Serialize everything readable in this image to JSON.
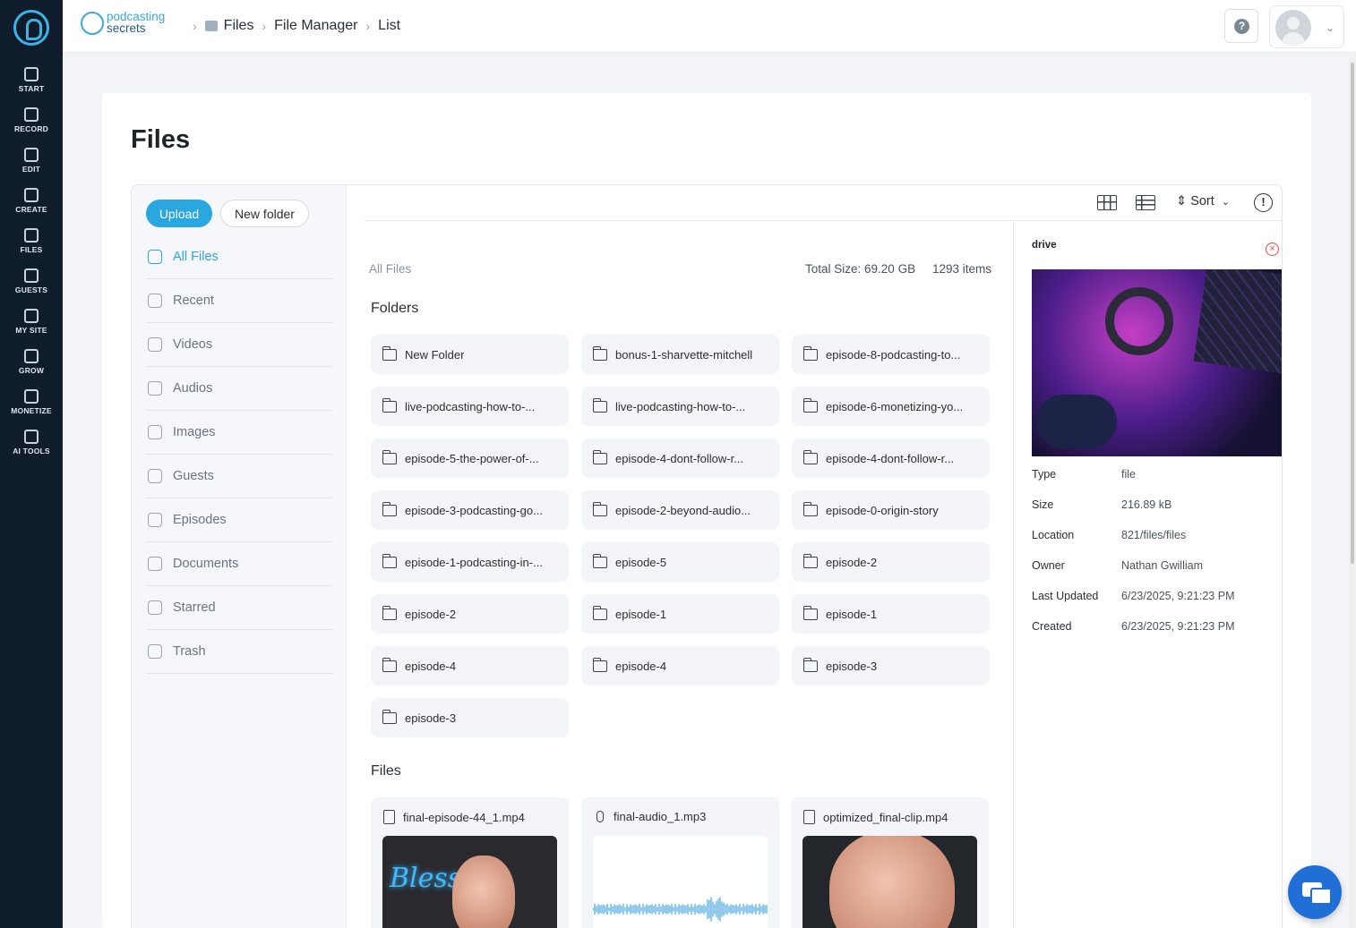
{
  "rail": {
    "items": [
      {
        "label": "START",
        "icon": "start-icon"
      },
      {
        "label": "RECORD",
        "icon": "microphone-icon"
      },
      {
        "label": "EDIT",
        "icon": "edit-icon"
      },
      {
        "label": "CREATE",
        "icon": "create-icon"
      },
      {
        "label": "FILES",
        "icon": "files-icon"
      },
      {
        "label": "GUESTS",
        "icon": "guests-icon"
      },
      {
        "label": "MY SITE",
        "icon": "site-icon"
      },
      {
        "label": "GROW",
        "icon": "chart-icon"
      },
      {
        "label": "MONETIZE",
        "icon": "monetize-icon"
      },
      {
        "label": "AI TOOLS",
        "icon": "ai-icon"
      }
    ]
  },
  "header": {
    "brand_line1": "podcasting",
    "brand_line2": "secrets",
    "breadcrumbs": [
      "Files",
      "File Manager",
      "List"
    ],
    "help_label": "?"
  },
  "page": {
    "title": "Files"
  },
  "sidebar": {
    "upload_label": "Upload",
    "new_folder_label": "New folder",
    "items": [
      {
        "label": "All Files",
        "icon": "folder-icon",
        "active": true
      },
      {
        "label": "Recent",
        "icon": "clock-icon"
      },
      {
        "label": "Videos",
        "icon": "video-icon"
      },
      {
        "label": "Audios",
        "icon": "music-icon"
      },
      {
        "label": "Images",
        "icon": "image-icon"
      },
      {
        "label": "Guests",
        "icon": "users-icon"
      },
      {
        "label": "Episodes",
        "icon": "episodes-icon"
      },
      {
        "label": "Documents",
        "icon": "document-icon"
      },
      {
        "label": "Starred",
        "icon": "star-icon"
      },
      {
        "label": "Trash",
        "icon": "trash-icon"
      }
    ]
  },
  "toolbar": {
    "sort_label": "Sort",
    "info_label": "!"
  },
  "content": {
    "location": "All Files",
    "total_size": "Total Size: 69.20 GB",
    "item_count": "1293 items",
    "folders_heading": "Folders",
    "files_heading": "Files",
    "folders": [
      "New Folder",
      "bonus-1-sharvette-mitchell",
      "episode-8-podcasting-to...",
      "live-podcasting-how-to-...",
      "live-podcasting-how-to-...",
      "episode-6-monetizing-yo...",
      "episode-5-the-power-of-...",
      "episode-4-dont-follow-r...",
      "episode-4-dont-follow-r...",
      "episode-3-podcasting-go...",
      "episode-2-beyond-audio...",
      "episode-0-origin-story",
      "episode-1-podcasting-in-...",
      "episode-5",
      "episode-2",
      "episode-2",
      "episode-1",
      "episode-1",
      "episode-4",
      "episode-4",
      "episode-3",
      "episode-3"
    ],
    "files": [
      {
        "name": "final-episode-44_1.mp4",
        "icon": "video-file-icon",
        "thumb_text": "Blesse"
      },
      {
        "name": "final-audio_1.mp3",
        "icon": "microphone-icon"
      },
      {
        "name": "optimized_final-clip.mp4",
        "icon": "video-file-icon"
      }
    ]
  },
  "detail": {
    "title": "drive",
    "rows": [
      {
        "k": "Type",
        "v": "file"
      },
      {
        "k": "Size",
        "v": "216.89 kB"
      },
      {
        "k": "Location",
        "v": "821/files/files"
      },
      {
        "k": "Owner",
        "v": "Nathan Gwilliam"
      },
      {
        "k": "Last Updated",
        "v": "6/23/2025, 9:21:23 PM"
      },
      {
        "k": "Created",
        "v": "6/23/2025, 9:21:23 PM"
      }
    ]
  },
  "colors": {
    "accent": "#2aa7df",
    "rail": "#0f1c2b",
    "brand": "#3fa7d6"
  }
}
